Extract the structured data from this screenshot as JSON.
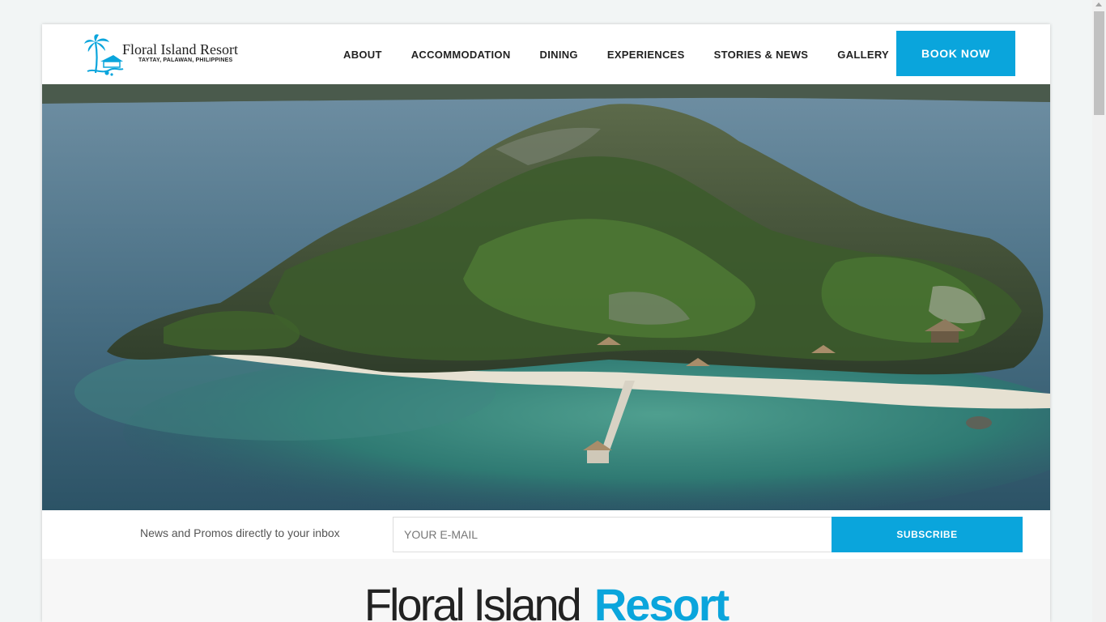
{
  "brand": {
    "name": "Floral Island Resort",
    "tagline": "TAYTAY, PALAWAN, PHILIPPINES"
  },
  "nav": {
    "items": [
      "ABOUT",
      "ACCOMMODATION",
      "DINING",
      "EXPERIENCES",
      "STORIES & NEWS",
      "GALLERY"
    ],
    "book_label": "BOOK NOW"
  },
  "hero": {
    "image": "aerial-island-photo"
  },
  "newsletter": {
    "text": "News and Promos directly to your inbox",
    "placeholder": "YOUR E-MAIL",
    "button": "SUBSCRIBE"
  },
  "intro": {
    "title_part1": "Floral Island",
    "title_part2": "Resort"
  },
  "colors": {
    "accent": "#0aa5dc",
    "text": "#222222"
  }
}
